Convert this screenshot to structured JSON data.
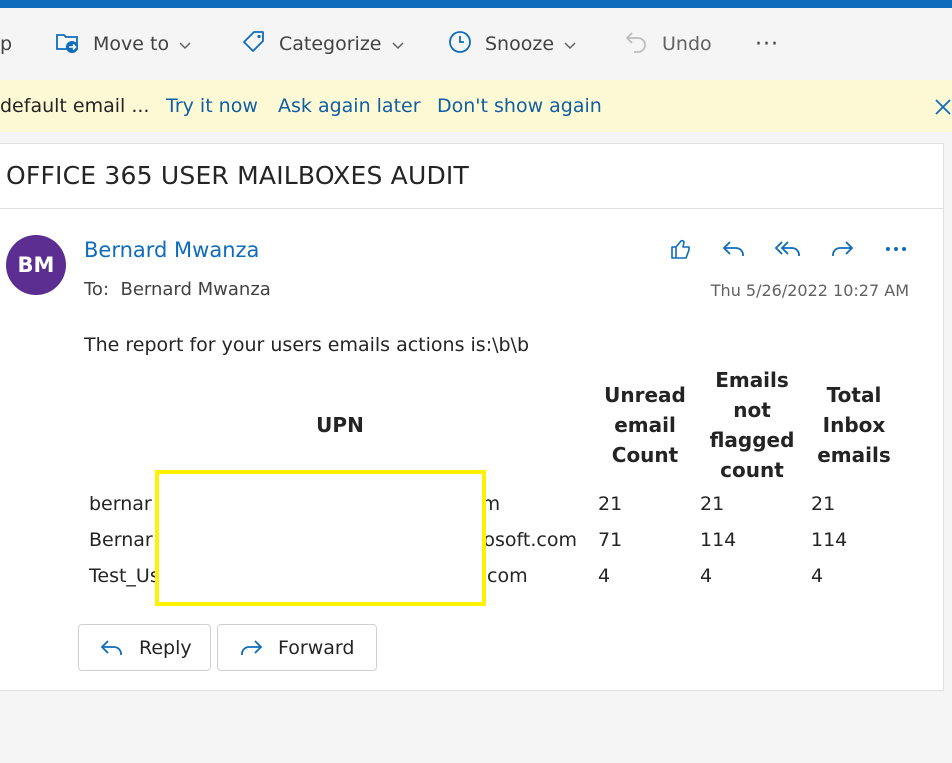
{
  "toolbar": {
    "partial_label": "p",
    "move_to": "Move to",
    "categorize": "Categorize",
    "snooze": "Snooze",
    "undo": "Undo",
    "more": "···"
  },
  "infobar": {
    "message": "default email ...",
    "try_now": "Try it now",
    "ask_later": "Ask again later",
    "dont_show": "Don't show again"
  },
  "email": {
    "subject": "OFFICE 365 USER MAILBOXES AUDIT",
    "avatar_initials": "BM",
    "sender": "Bernard Mwanza",
    "to_label": "To:",
    "to_name": "Bernard Mwanza",
    "date": "Thu 5/26/2022 10:27 AM",
    "body": "The report for your users emails actions is:\\b\\b"
  },
  "table": {
    "headers": {
      "upn": "UPN",
      "unread": [
        "Unread",
        "email",
        "Count"
      ],
      "not_flagged": [
        "Emails",
        "not",
        "flagged",
        "count"
      ],
      "total": [
        "Total",
        "Inbox",
        "emails"
      ]
    },
    "rows": [
      {
        "upn_start": "bernar",
        "upn_end": "om",
        "unread": "21",
        "not_flagged": "21",
        "total": "21"
      },
      {
        "upn_start": "Bernar",
        "upn_end": "rosoft.com",
        "unread": "71",
        "not_flagged": "114",
        "total": "114"
      },
      {
        "upn_start": "Test_Us",
        "upn_end": "com",
        "unread": "4",
        "not_flagged": "4",
        "total": "4"
      }
    ]
  },
  "buttons": {
    "reply": "Reply",
    "forward": "Forward"
  },
  "colors": {
    "accent": "#0f6cbd",
    "avatar": "#5c2e91",
    "infobar_bg": "#fdf9d4",
    "redaction_border": "#fff200"
  }
}
